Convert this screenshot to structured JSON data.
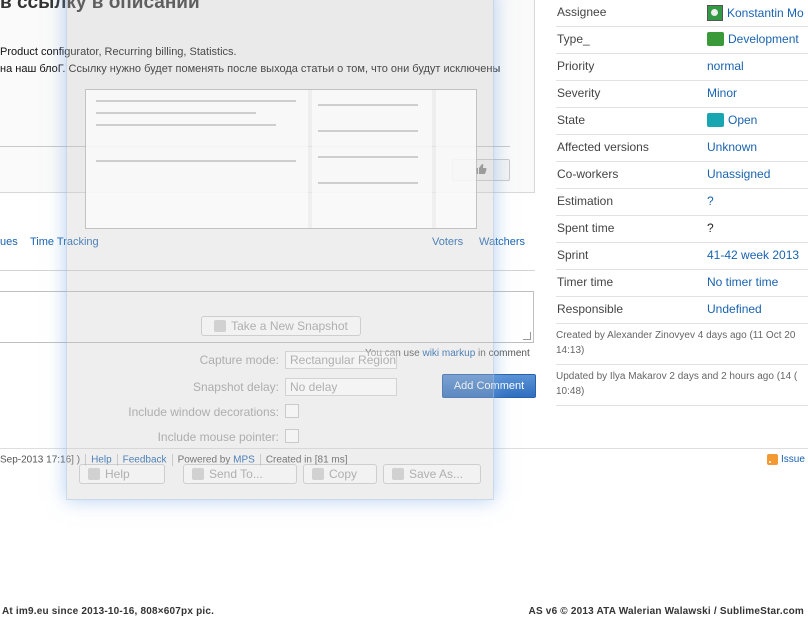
{
  "issue": {
    "title": "в ссылку в описании",
    "description_line1": "Product configurator, Recurring billing, Statistics.",
    "description_line2": "на наш блоГ. Ссылку нужно будет поменять после выхода статьи о том, что они будут исключены"
  },
  "tabs": {
    "issues": "ues",
    "time_tracking": "Time Tracking",
    "voters": "Voters",
    "watchers": "Watchers"
  },
  "comment": {
    "markup_note_prefix": "You can use",
    "markup_link": "wiki markup",
    "markup_note_suffix": "in comment",
    "add_button": "Add Comment"
  },
  "properties": [
    {
      "label": "Assignee",
      "value": "Konstantin Mo",
      "icon": "avatar-icon"
    },
    {
      "label": "Type_",
      "value": "Development",
      "color": "#3a9a3a"
    },
    {
      "label": "Priority",
      "value": "normal"
    },
    {
      "label": "Severity",
      "value": "Minor"
    },
    {
      "label": "State",
      "value": "Open",
      "color": "#1aa6b0"
    },
    {
      "label": "Affected versions",
      "value": "Unknown"
    },
    {
      "label": "Co-workers",
      "value": "Unassigned"
    },
    {
      "label": "Estimation",
      "value": "?"
    },
    {
      "label": "Spent time",
      "value": "?"
    },
    {
      "label": "Sprint",
      "value": "41-42 week 2013"
    },
    {
      "label": "Timer time",
      "value": "No timer time"
    },
    {
      "label": "Responsible",
      "value": "Undefined"
    }
  ],
  "meta": {
    "created": "Created by Alexander Zinovyev 4 days ago (11 Oct 20 14:13)",
    "updated": "Updated by Ilya Makarov 2 days and 2 hours ago (14 ( 10:48)"
  },
  "footer": {
    "build": "Sep-2013 17:16] )",
    "help": "Help",
    "feedback": "Feedback",
    "powered_by": "Powered by",
    "mps": "MPS",
    "created_in": "Created in [81 ms]",
    "issues_link": "Issue"
  },
  "snapshot_tool": {
    "take_snapshot": "Take a New Snapshot",
    "capture_mode_label": "Capture mode:",
    "capture_mode_value": "Rectangular Region",
    "snapshot_delay_label": "Snapshot delay:",
    "snapshot_delay_value": "No delay",
    "include_window_label": "Include window decorations:",
    "include_pointer_label": "Include mouse pointer:",
    "help_button": "Help",
    "send_to_button": "Send To...",
    "copy_button": "Copy",
    "save_as_button": "Save As..."
  },
  "watermark": {
    "left": "At im9.eu since 2013-10-16, 808×607px pic.",
    "right": "AS v6 © 2013 ATA Walerian Walawski / SublimeStar.com"
  }
}
